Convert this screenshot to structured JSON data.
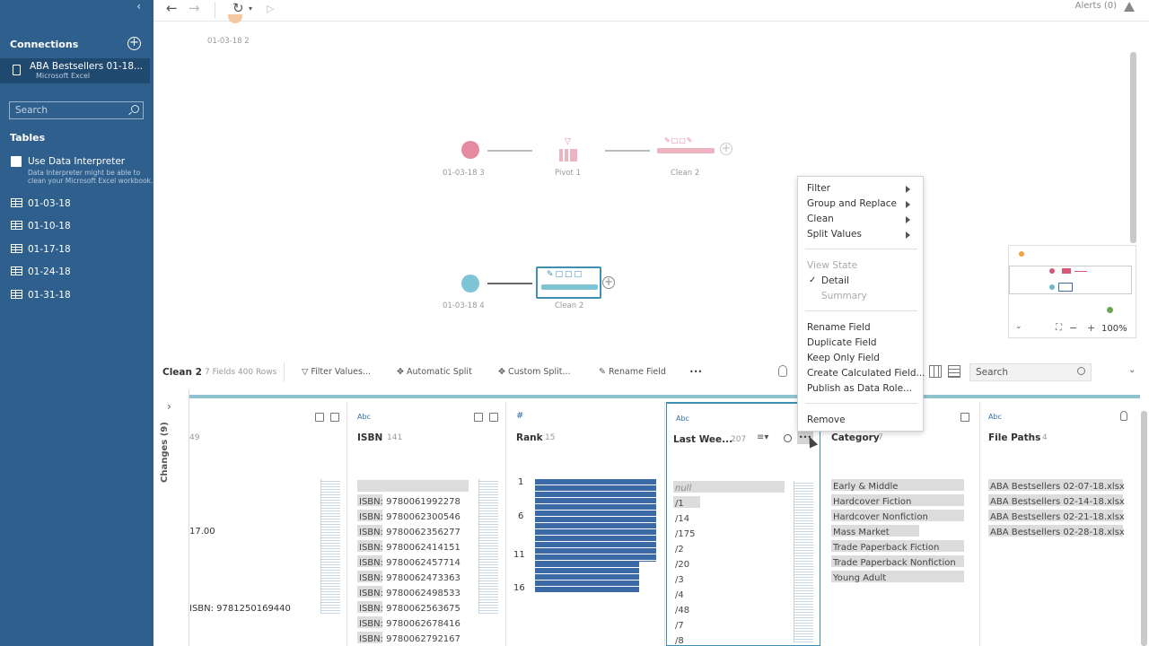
{
  "sidebar": {
    "connections_title": "Connections",
    "connection": {
      "name": "ABA Bestsellers 01-18...",
      "type": "Microsoft Excel"
    },
    "search_placeholder": "Search",
    "tables_title": "Tables",
    "interpreter_label": "Use Data Interpreter",
    "interpreter_desc": "Data Interpreter might be able to clean your Microsoft Excel workbook.",
    "tables": [
      "01-03-18",
      "01-10-18",
      "01-17-18",
      "01-24-18",
      "01-31-18"
    ]
  },
  "topbar": {
    "alerts": "Alerts (0)"
  },
  "canvas": {
    "top_label": "01-03-18 2",
    "flow1": {
      "input": "01-03-18 3",
      "pivot": "Pivot 1",
      "clean": "Clean 2"
    },
    "flow2": {
      "input": "01-03-18 4",
      "clean": "Clean 2"
    },
    "zoom": "100%"
  },
  "profile_toolbar": {
    "step": "Clean 2",
    "meta": "7 Fields  400 Rows",
    "tools": [
      "Filter Values...",
      "Automatic Split",
      "Custom Split...",
      "Rename Field"
    ],
    "more": "•••",
    "search_placeholder": "Search"
  },
  "changes_label": "Changes (9)",
  "columns": {
    "partial": {
      "count": "49",
      "value1": "17.00",
      "value2": "ISBN: 9781250169440"
    },
    "isbn": {
      "type": "Abc",
      "name": "ISBN",
      "count": "141",
      "values": [
        "ISBN: 9780061992278",
        "ISBN: 9780062300546",
        "ISBN: 9780062356277",
        "ISBN: 9780062414151",
        "ISBN: 9780062457714",
        "ISBN: 9780062473363",
        "ISBN: 9780062498533",
        "ISBN: 9780062563675",
        "ISBN: 9780062678416",
        "ISBN: 9780062792167"
      ]
    },
    "rank": {
      "type": "#",
      "name": "Rank",
      "count": "15",
      "ticks": [
        "1",
        "6",
        "11",
        "16"
      ]
    },
    "lastweek": {
      "type": "Abc",
      "name": "Last Wee...",
      "count": "207",
      "values": [
        "null",
        "/1",
        "/14",
        "/175",
        "/2",
        "/20",
        "/3",
        "/4",
        "/48",
        "/7",
        "/8"
      ]
    },
    "category": {
      "name": "Category",
      "count": "7",
      "values": [
        "Early & Middle",
        "Hardcover Fiction",
        "Hardcover Nonfiction",
        "Mass Market",
        "Trade Paperback Fiction",
        "Trade Paperback Nonfiction",
        "Young Adult"
      ]
    },
    "filepaths": {
      "type": "Abc",
      "name": "File Paths",
      "count": "4",
      "values": [
        "ABA Bestsellers 02-07-18.xlsx",
        "ABA Bestsellers 02-14-18.xlsx",
        "ABA Bestsellers 02-21-18.xlsx",
        "ABA Bestsellers 02-28-18.xlsx"
      ]
    }
  },
  "context_menu": {
    "filter": "Filter",
    "group_replace": "Group and Replace",
    "clean": "Clean",
    "split_values": "Split Values",
    "view_state": "View State",
    "detail": "Detail",
    "summary": "Summary",
    "rename": "Rename Field",
    "duplicate": "Duplicate Field",
    "keep_only": "Keep Only Field",
    "create_calc": "Create Calculated Field...",
    "publish": "Publish as Data Role...",
    "remove": "Remove"
  },
  "colors": {
    "sidebar": "#2f5f8c",
    "accent": "#2f6fa8",
    "teal": "#5fb3c7",
    "pink": "#e07a8f",
    "bar": "#3b6aa6"
  }
}
